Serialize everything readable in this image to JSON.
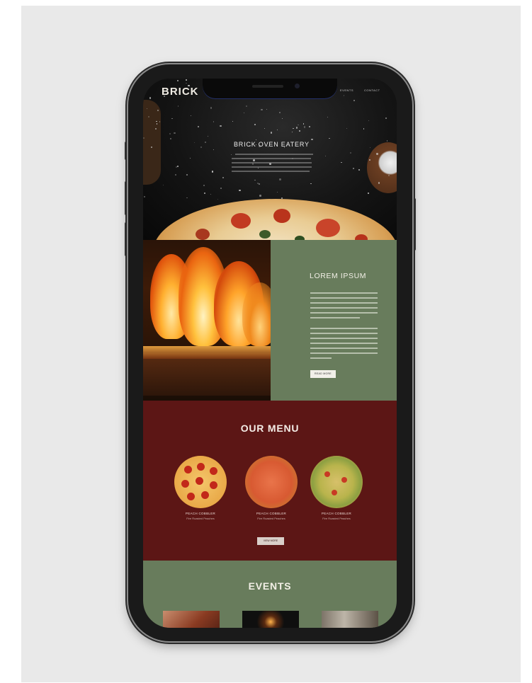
{
  "site": {
    "logo": "BRICK",
    "nav": [
      "EVENTS",
      "CONTACT"
    ]
  },
  "hero": {
    "title": "BRICK OVEN EATERY"
  },
  "about": {
    "title": "LOREM IPSUM",
    "button_label": "READ MORE"
  },
  "menu": {
    "title": "OUR MENU",
    "items": [
      {
        "name": "PEACH COBBLER",
        "subtitle": "Fire Roasted Peaches"
      },
      {
        "name": "PEACH COBBLER",
        "subtitle": "Fire Roasted Peaches"
      },
      {
        "name": "PEACH COBBLER",
        "subtitle": "Fire Roasted Peaches"
      }
    ],
    "button_label": "VIEW MORE"
  },
  "events": {
    "title": "EVENTS"
  },
  "colors": {
    "menu_background": "#5c1615",
    "green_panel": "#687c5c",
    "page_background": "#e9e9e9"
  }
}
